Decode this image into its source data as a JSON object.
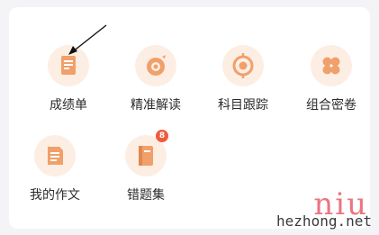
{
  "tiles": [
    {
      "label": "成绩单",
      "icon": "report-card-icon"
    },
    {
      "label": "精准解读",
      "icon": "precise-analysis-icon"
    },
    {
      "label": "科目跟踪",
      "icon": "subject-tracking-icon"
    },
    {
      "label": "组合密卷",
      "icon": "combined-paper-icon"
    },
    {
      "label": "我的作文",
      "icon": "my-essay-icon"
    },
    {
      "label": "错题集",
      "icon": "mistake-book-icon",
      "badge": "8"
    }
  ],
  "watermark": {
    "big": "niu",
    "small": "hezhong.net"
  },
  "colors": {
    "icon_bg": "#fdeee4",
    "icon_accent": "#f0a06a",
    "badge": "#f05a3c",
    "arrow": "#111111"
  }
}
